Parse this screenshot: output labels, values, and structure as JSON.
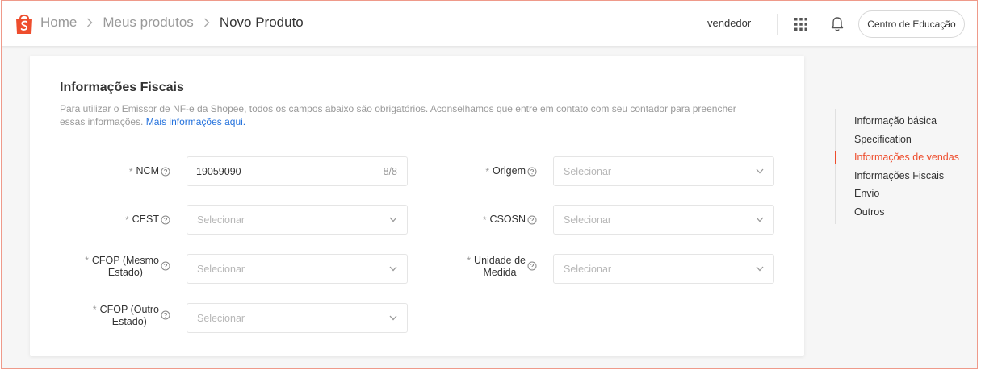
{
  "colors": {
    "brand": "#ee4d2d",
    "link": "#2673dd",
    "frame_border": "#ef9a8a"
  },
  "header": {
    "logo_icon": "shopee-bag-icon",
    "breadcrumbs": [
      "Home",
      "Meus produtos",
      "Novo Produto"
    ],
    "username": "vendedor",
    "apps_icon": "grid-apps-icon",
    "notifications_icon": "bell-icon",
    "education_label": "Centro de Educação"
  },
  "section": {
    "title": "Informações Fiscais",
    "description": "Para utilizar o Emissor de NF-e da Shopee, todos os campos abaixo são obrigatórios. Aconselhamos que entre em contato com seu contador para preencher essas informações.",
    "more_link": "Mais informações aqui."
  },
  "fields": {
    "ncm": {
      "label": "NCM",
      "value": "19059090",
      "counter": "8/8"
    },
    "origem": {
      "label": "Origem",
      "placeholder": "Selecionar"
    },
    "cest": {
      "label": "CEST",
      "placeholder": "Selecionar"
    },
    "csosn": {
      "label": "CSOSN",
      "placeholder": "Selecionar"
    },
    "cfop_mesmo": {
      "label_line1": "CFOP (Mesmo",
      "label_line2": "Estado)",
      "placeholder": "Selecionar"
    },
    "unidade": {
      "label_line1": "Unidade de",
      "label_line2": "Medida",
      "placeholder": "Selecionar"
    },
    "cfop_outro": {
      "label_line1": "CFOP (Outro",
      "label_line2": "Estado)",
      "placeholder": "Selecionar"
    }
  },
  "required_mark": "*",
  "anchor_nav": {
    "items": [
      {
        "label": "Informação básica",
        "active": false
      },
      {
        "label": "Specification",
        "active": false
      },
      {
        "label": "Informações de vendas",
        "active": true
      },
      {
        "label": "Informações Fiscais",
        "active": false
      },
      {
        "label": "Envio",
        "active": false
      },
      {
        "label": "Outros",
        "active": false
      }
    ]
  }
}
